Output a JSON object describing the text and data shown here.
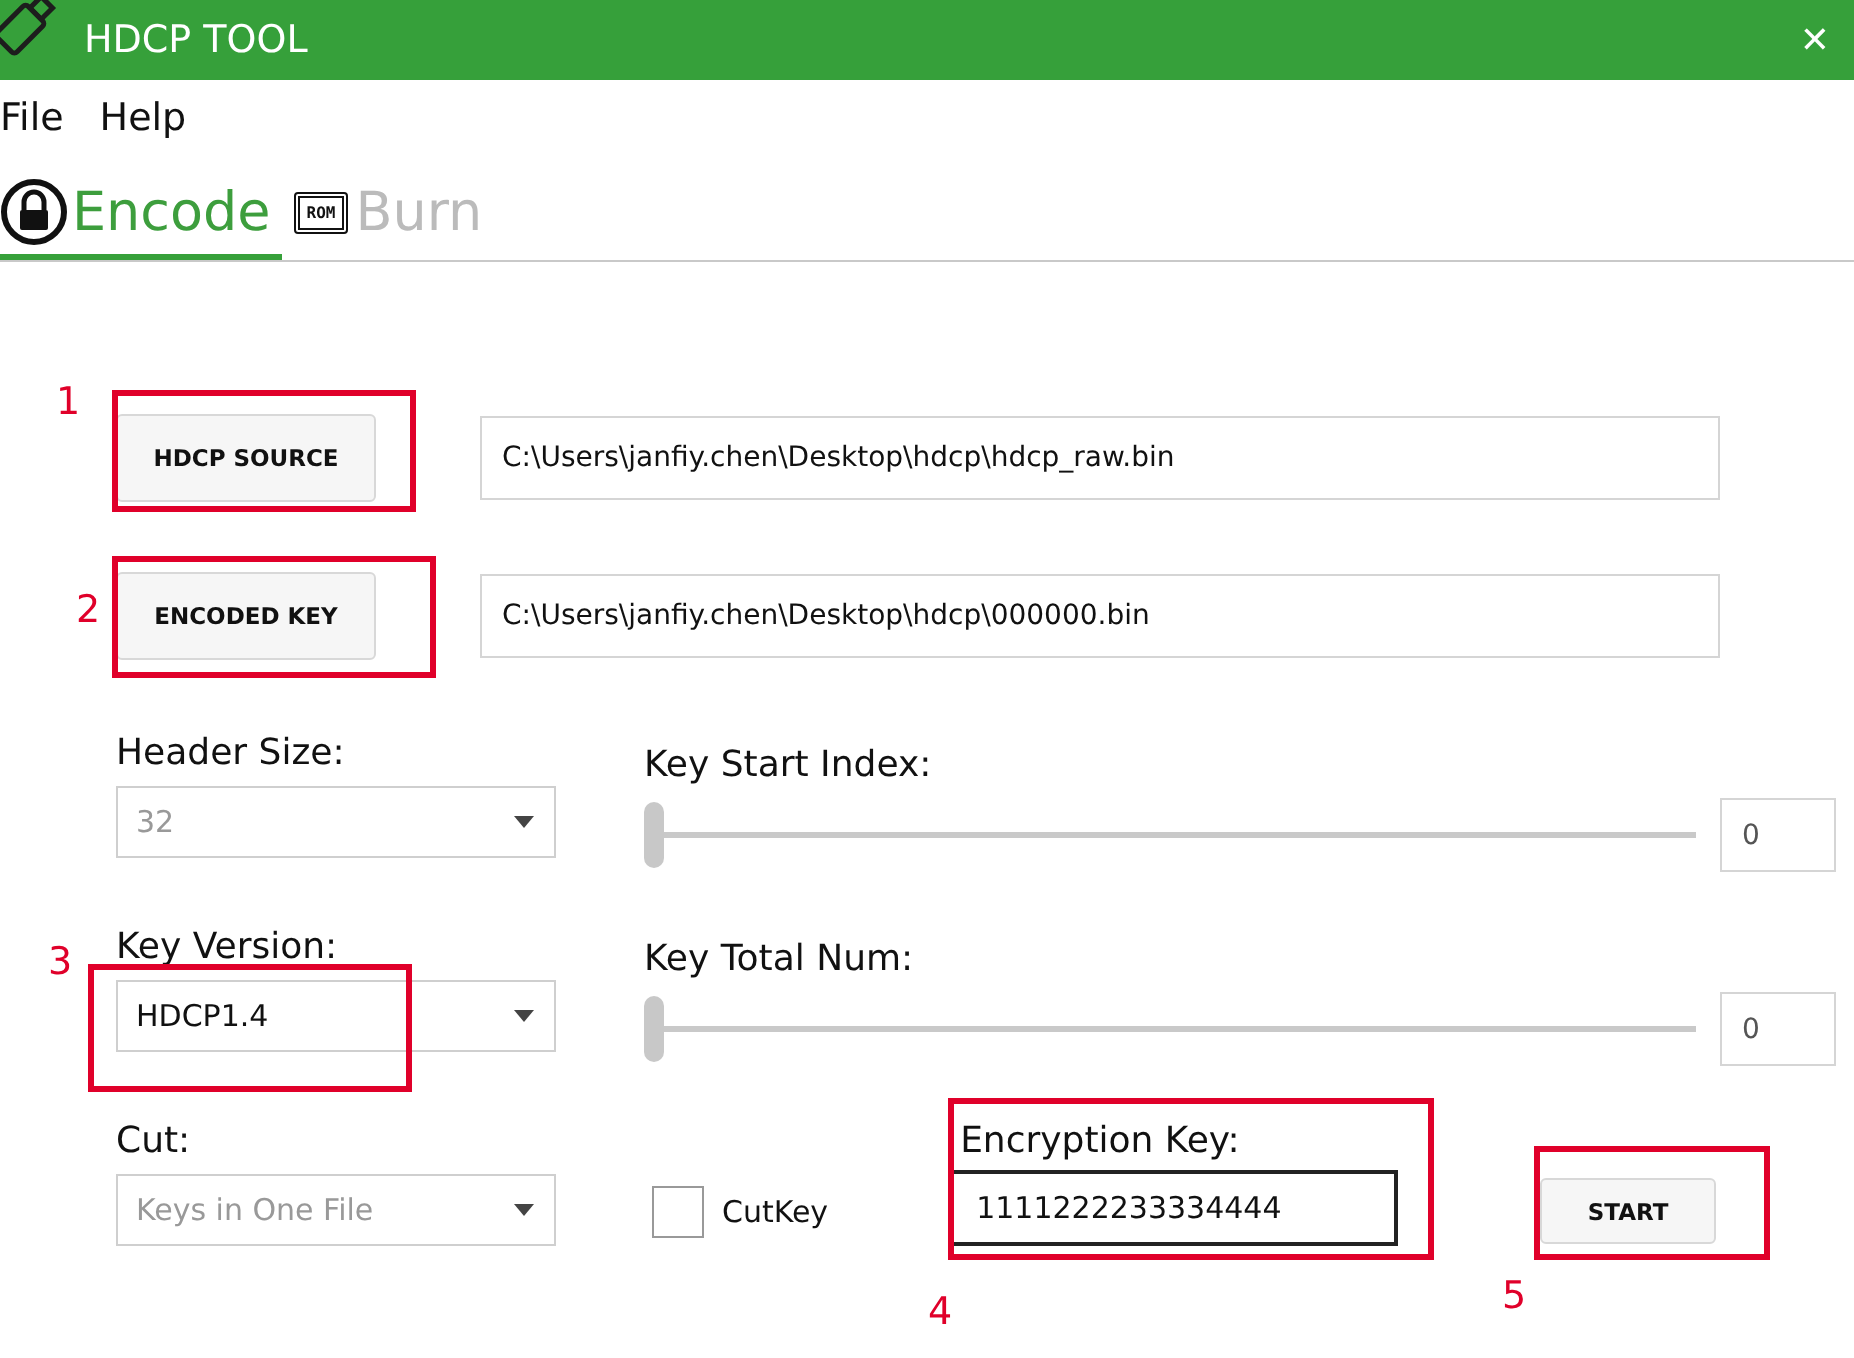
{
  "window": {
    "title": "HDCP TOOL",
    "close": "✕"
  },
  "menu": [
    "File",
    "Help"
  ],
  "tabs": [
    {
      "label": "Encode",
      "kind": "lock",
      "selected": true
    },
    {
      "label": "Burn",
      "kind": "chip",
      "icon_label": "ROM",
      "selected": false
    }
  ],
  "files": [
    {
      "button": "HDCP SOURCE",
      "value": "C:\\Users\\janfiy.chen\\Desktop\\hdcp\\hdcp_raw.bin"
    },
    {
      "button": "ENCODED KEY",
      "value": "C:\\Users\\janfiy.chen\\Desktop\\hdcp\\000000.bin"
    }
  ],
  "selects": [
    {
      "label": "Header Size:",
      "value": "32",
      "disabled": true
    },
    {
      "label": "Key Version:",
      "value": "HDCP1.4",
      "disabled": false
    },
    {
      "label": "Cut:",
      "value": "Keys in One File",
      "disabled": true
    }
  ],
  "sliders": [
    {
      "label": "Key Start Index:",
      "level": 0,
      "value": "0"
    },
    {
      "label": "Key Total Num:",
      "level": 0,
      "value": "0"
    }
  ],
  "checkbox": {
    "label": "CutKey",
    "checked": false
  },
  "encryption": {
    "label": "Encryption Key:",
    "value": "1111222233334444"
  },
  "start_button": "START",
  "annotations": [
    {
      "label": "1"
    },
    {
      "label": "2"
    },
    {
      "label": "3"
    },
    {
      "label": "4"
    },
    {
      "label": "5"
    }
  ]
}
